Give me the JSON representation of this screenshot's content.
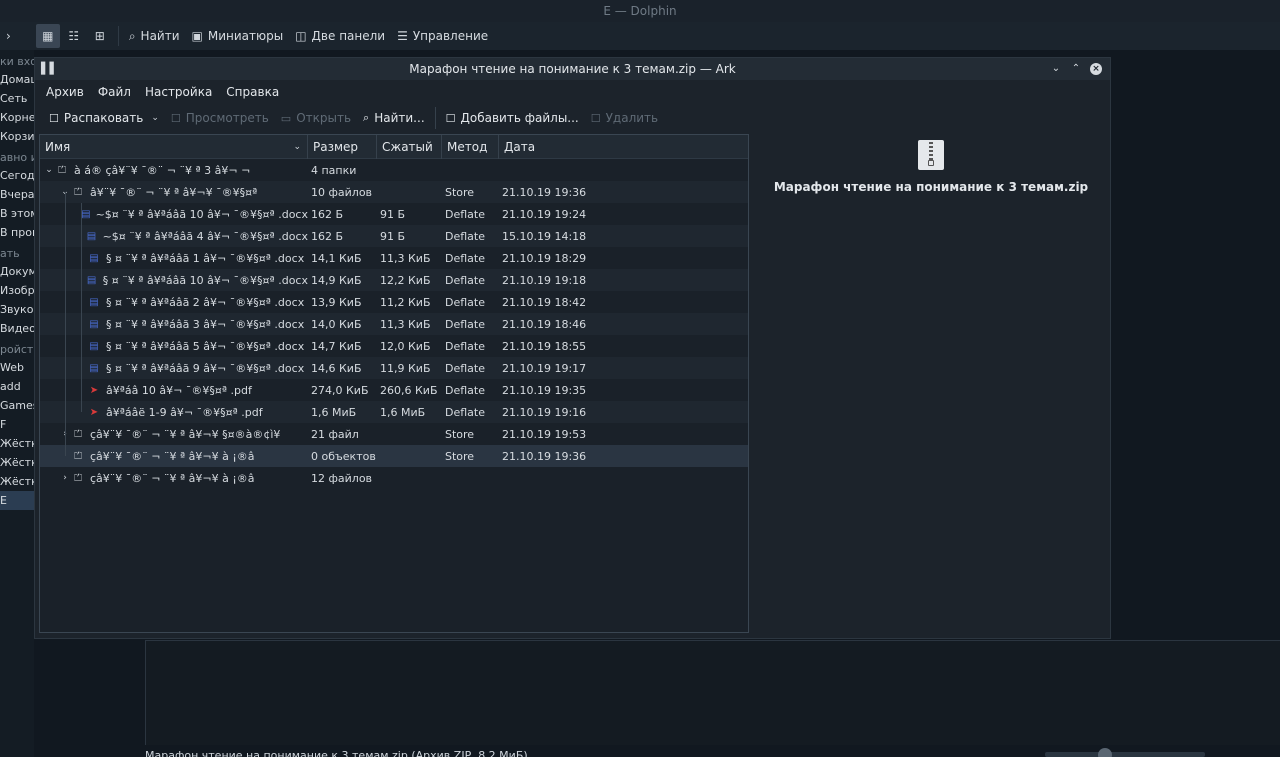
{
  "dolphin": {
    "title": "E — Dolphin",
    "toolbar": {
      "find": "Найти",
      "previews": "Миниатюры",
      "split": "Две панели",
      "control": "Управление"
    },
    "sidebar": [
      {
        "kind": "head",
        "label": "ки вхо"
      },
      {
        "kind": "item",
        "label": "Домаш"
      },
      {
        "kind": "item",
        "label": "Сеть"
      },
      {
        "kind": "item",
        "label": "Корне"
      },
      {
        "kind": "item",
        "label": "Корзин"
      },
      {
        "kind": "head",
        "label": "авно и"
      },
      {
        "kind": "item",
        "label": "Сегодн"
      },
      {
        "kind": "item",
        "label": "Вчера"
      },
      {
        "kind": "item",
        "label": "В этом"
      },
      {
        "kind": "item",
        "label": "В проц"
      },
      {
        "kind": "head",
        "label": "ать"
      },
      {
        "kind": "item",
        "label": "Докуме"
      },
      {
        "kind": "item",
        "label": "Изобра"
      },
      {
        "kind": "item",
        "label": "Звуков"
      },
      {
        "kind": "item",
        "label": "Видео"
      },
      {
        "kind": "head",
        "label": "ройств"
      },
      {
        "kind": "item",
        "label": "Web"
      },
      {
        "kind": "item",
        "label": "add"
      },
      {
        "kind": "item",
        "label": "Games"
      },
      {
        "kind": "item",
        "label": "F"
      },
      {
        "kind": "item",
        "label": "Жёстки"
      },
      {
        "kind": "item",
        "label": "Жёстки"
      },
      {
        "kind": "item",
        "label": "Жёстки"
      },
      {
        "kind": "item",
        "label": "E",
        "selected": true
      }
    ],
    "status": "Марафон чтение на понимание к 3 темам.zip (Архив ZIP, 8,2 МиБ)"
  },
  "ark": {
    "title": "Марафон чтение на понимание к 3 темам.zip — Ark",
    "menu": [
      "Архив",
      "Файл",
      "Настройка",
      "Справка"
    ],
    "toolbar": {
      "extract": "Распаковать",
      "preview": "Просмотреть",
      "open": "Открыть",
      "find": "Найти...",
      "add_files": "Добавить файлы...",
      "delete": "Удалить"
    },
    "columns": {
      "name": "Имя",
      "size": "Размер",
      "compressed": "Сжатый",
      "method": "Метод",
      "date": "Дата"
    },
    "rows": [
      {
        "level": 0,
        "expander": "down",
        "icon": "folder",
        "name": "  à á® çâ¥¨¥  ¯®¨ ¬ ¨¥ ª 3 â¥¬ ¬",
        "size": "4 папки",
        "compressed": "",
        "method": "",
        "date": ""
      },
      {
        "level": 1,
        "expander": "down",
        "icon": "folder",
        "name": "â¥¨¥  ¯®¨ ¬ ¨¥ ª â¥¬¥ ¯®¥§¤ª ",
        "size": "10 файлов",
        "compressed": "",
        "method": "Store",
        "date": "21.10.19 19:36"
      },
      {
        "level": 2,
        "expander": "",
        "icon": "doc",
        "name": "~$¤ ¨¥ ª â¥ªáâã 10 â¥¬  ¯®¥§¤ª .docx",
        "size": "162 Б",
        "compressed": "91 Б",
        "method": "Deflate",
        "date": "21.10.19 19:24"
      },
      {
        "level": 2,
        "expander": "",
        "icon": "doc",
        "name": "~$¤ ¨¥ ª â¥ªáâã 4 â¥¬  ¯®¥§¤ª .docx",
        "size": "162 Б",
        "compressed": "91 Б",
        "method": "Deflate",
        "date": "15.10.19 14:18"
      },
      {
        "level": 2,
        "expander": "",
        "icon": "doc",
        "name": "§ ¤ ¨¥ ª â¥ªáâã 1 â¥¬  ¯®¥§¤ª .docx",
        "size": "14,1 КиБ",
        "compressed": "11,3 КиБ",
        "method": "Deflate",
        "date": "21.10.19 18:29"
      },
      {
        "level": 2,
        "expander": "",
        "icon": "doc",
        "name": "§ ¤ ¨¥ ª â¥ªáâã 10 â¥¬  ¯®¥§¤ª .docx",
        "size": "14,9 КиБ",
        "compressed": "12,2 КиБ",
        "method": "Deflate",
        "date": "21.10.19 19:18"
      },
      {
        "level": 2,
        "expander": "",
        "icon": "doc",
        "name": "§ ¤ ¨¥ ª â¥ªáâã 2 â¥¬  ¯®¥§¤ª .docx",
        "size": "13,9 КиБ",
        "compressed": "11,2 КиБ",
        "method": "Deflate",
        "date": "21.10.19 18:42"
      },
      {
        "level": 2,
        "expander": "",
        "icon": "doc",
        "name": "§ ¤ ¨¥ ª â¥ªáâã 3 â¥¬  ¯®¥§¤ª .docx",
        "size": "14,0 КиБ",
        "compressed": "11,3 КиБ",
        "method": "Deflate",
        "date": "21.10.19 18:46"
      },
      {
        "level": 2,
        "expander": "",
        "icon": "doc",
        "name": "§ ¤ ¨¥ ª â¥ªáâã 5 â¥¬  ¯®¥§¤ª .docx",
        "size": "14,7 КиБ",
        "compressed": "12,0 КиБ",
        "method": "Deflate",
        "date": "21.10.19 18:55"
      },
      {
        "level": 2,
        "expander": "",
        "icon": "doc",
        "name": "§ ¤ ¨¥ ª â¥ªáâã 9 â¥¬  ¯®¥§¤ª .docx",
        "size": "14,6 КиБ",
        "compressed": "11,9 КиБ",
        "method": "Deflate",
        "date": "21.10.19 19:17"
      },
      {
        "level": 2,
        "expander": "",
        "icon": "pdf",
        "name": "â¥ªáâ 10 â¥¬  ¯®¥§¤ª .pdf",
        "size": "274,0 КиБ",
        "compressed": "260,6 КиБ",
        "method": "Deflate",
        "date": "21.10.19 19:35"
      },
      {
        "level": 2,
        "expander": "",
        "icon": "pdf",
        "name": "â¥ªáâë 1-9 â¥¬  ¯®¥§¤ª .pdf",
        "size": "1,6 МиБ",
        "compressed": "1,6 МиБ",
        "method": "Deflate",
        "date": "21.10.19 19:16"
      },
      {
        "level": 1,
        "expander": "right",
        "icon": "folder",
        "name": "çâ¥¨¥  ¯®¨ ¬ ¨¥ ª â¥¬¥ §¤®à®¢ì¥",
        "size": "21 файл",
        "compressed": "",
        "method": "Store",
        "date": "21.10.19 19:53"
      },
      {
        "level": 1,
        "expander": "",
        "icon": "folder",
        "name": "çâ¥¨¥  ¯®¨ ¬ ¨¥ ª â¥¬¥ à ¡®â ",
        "size": "0 объектов",
        "compressed": "",
        "method": "Store",
        "date": "21.10.19 19:36",
        "highlight": true
      },
      {
        "level": 1,
        "expander": "right",
        "icon": "folder",
        "name": "çâ¥¨¥  ¯®¨ ¬ ¨¥ ª â¥¬¥ à ¡®â ",
        "size": "12 файлов",
        "compressed": "",
        "method": "",
        "date": ""
      }
    ],
    "info_name": "Марафон чтение на понимание к 3 темам.zip"
  }
}
